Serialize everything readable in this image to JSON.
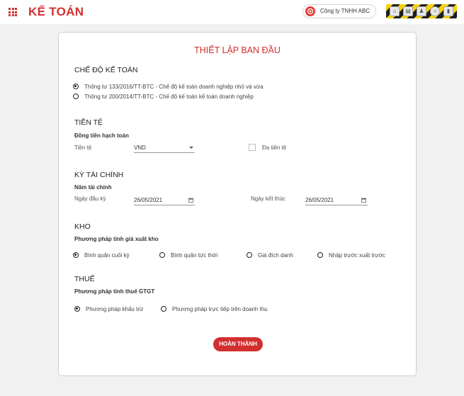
{
  "app": {
    "title": "KẾ TOÁN"
  },
  "header": {
    "company_name": "Công ty TNHH ABC",
    "tools": [
      "home-icon",
      "chat-icon",
      "users-icon",
      "help-icon",
      "info-icon"
    ]
  },
  "page": {
    "title": "THIẾT LẬP BAN ĐẦU",
    "finish_button": "HOÀN THÀNH"
  },
  "accounting_regime": {
    "heading": "CHẾ ĐỘ KẾ TOÁN",
    "options": [
      {
        "label": "Thông tư 133/2016/TT-BTC - Chế độ kế toán doanh nghiệp nhỏ và vừa",
        "selected": true
      },
      {
        "label": "Thông tư 200/2014/TT-BTC - Chế độ kế toán kế toán doanh nghiệp",
        "selected": false
      }
    ]
  },
  "currency": {
    "heading": "TIỀN TỆ",
    "subheading": "Đồng tiền hạch toán",
    "field_label": "Tiền tệ",
    "value": "VND",
    "multi_currency_label": "Đa tiền tệ",
    "multi_currency_checked": false
  },
  "fiscal_period": {
    "heading": "KỲ TÀI CHÍNH",
    "subheading": "Năm tài chính",
    "start_label": "Ngày đầu kỳ",
    "start_value": "26/05/2021",
    "end_label": "Ngày kết thúc",
    "end_value": "26/05/2021"
  },
  "warehouse": {
    "heading": "KHO",
    "subheading": "Phương pháp tính giá xuất kho",
    "options": [
      {
        "label": "Bình quân cuối kỳ",
        "selected": true
      },
      {
        "label": "Bình quân tức thời",
        "selected": false
      },
      {
        "label": "Giá đích danh",
        "selected": false
      },
      {
        "label": "Nhập trước xuất trước",
        "selected": false
      }
    ]
  },
  "tax": {
    "heading": "THUẾ",
    "subheading": "Phương pháp tính thuế GTGT",
    "options": [
      {
        "label": "Phương pháp khấu trừ",
        "selected": true
      },
      {
        "label": "Phương pháp trực tiếp trên doanh thu",
        "selected": false
      }
    ]
  }
}
